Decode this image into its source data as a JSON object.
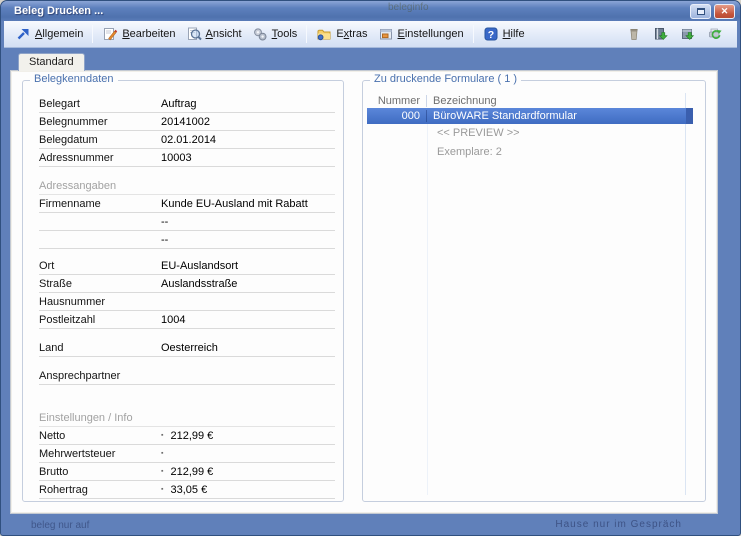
{
  "window": {
    "title": "Beleg Drucken ...",
    "close_glyph": "✕"
  },
  "toolbar": {
    "menus": [
      {
        "pre": "",
        "key": "A",
        "post": "llgemein",
        "icon": "arrow-up-right-icon"
      },
      {
        "pre": "",
        "key": "B",
        "post": "earbeiten",
        "icon": "edit-icon"
      },
      {
        "pre": "",
        "key": "A",
        "post": "nsicht",
        "icon": "magnifier-icon"
      },
      {
        "pre": "",
        "key": "T",
        "post": "ools",
        "icon": "gears-icon"
      },
      {
        "pre": "E",
        "key": "x",
        "post": "tras",
        "icon": "folder-icon"
      },
      {
        "pre": "",
        "key": "E",
        "post": "instellungen",
        "icon": "settings-icon"
      },
      {
        "pre": "",
        "key": "H",
        "post": "ilfe",
        "icon": "help-icon"
      }
    ],
    "right_icons": [
      "trash-icon",
      "book-import-icon",
      "box-export-icon",
      "printer-refresh-icon"
    ]
  },
  "tabs": {
    "standard": "Standard"
  },
  "left_panel": {
    "title": "Belegkenndaten",
    "marker": "▪",
    "sections": {
      "address": "Adressangaben",
      "settings": "Einstellungen / Info"
    },
    "fields": {
      "belegart": {
        "label": "Belegart",
        "value": "Auftrag"
      },
      "belegnummer": {
        "label": "Belegnummer",
        "value": "20141002"
      },
      "belegdatum": {
        "label": "Belegdatum",
        "value": "02.01.2014"
      },
      "adressnummer": {
        "label": "Adressnummer",
        "value": "10003"
      },
      "firmenname": {
        "label": "Firmenname",
        "value": "Kunde EU-Ausland mit Rabatt"
      },
      "zusatz1": {
        "label": "",
        "value": "--"
      },
      "zusatz2": {
        "label": "",
        "value": "--"
      },
      "ort": {
        "label": "Ort",
        "value": "EU-Auslandsort"
      },
      "strasse": {
        "label": "Straße",
        "value": "Auslandsstraße"
      },
      "hausnummer": {
        "label": "Hausnummer",
        "value": ""
      },
      "postleitzahl": {
        "label": "Postleitzahl",
        "value": "1004"
      },
      "land": {
        "label": "Land",
        "value": "Oesterreich"
      },
      "ansprechpartner": {
        "label": "Ansprechpartner",
        "value": ""
      },
      "netto": {
        "label": "Netto",
        "value": "212,99 €"
      },
      "mehrwertsteuer": {
        "label": "Mehrwertsteuer",
        "value": ""
      },
      "brutto": {
        "label": "Brutto",
        "value": "212,99 €"
      },
      "rohertrag": {
        "label": "Rohertrag",
        "value": "33,05 €"
      }
    }
  },
  "right_panel": {
    "title": "Zu druckende Formulare ( 1 )",
    "columns": {
      "nummer": "Nummer",
      "bezeichnung": "Bezeichnung"
    },
    "selected_row": {
      "nummer": "000",
      "bezeichnung": "BüroWARE Standardformular"
    },
    "preview": "<< PREVIEW >>",
    "exemplare": "Exemplare: 2"
  },
  "artifacts": {
    "top": "beleginfo",
    "bottom_left": "beleg nur auf",
    "bottom_right": "Hause nur im Gespräch"
  }
}
